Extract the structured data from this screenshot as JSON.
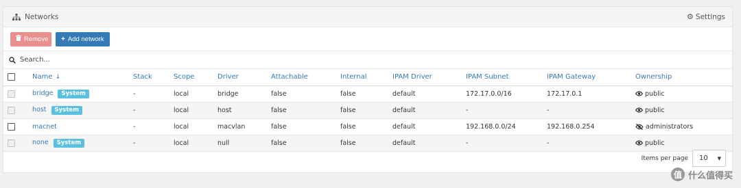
{
  "panel": {
    "title": "Networks",
    "settings_label": "Settings"
  },
  "toolbar": {
    "remove_label": "Remove",
    "add_label": "Add network"
  },
  "search": {
    "placeholder": "Search..."
  },
  "table": {
    "headers": {
      "name": "Name",
      "stack": "Stack",
      "scope": "Scope",
      "driver": "Driver",
      "attachable": "Attachable",
      "internal": "Internal",
      "ipam_driver": "IPAM Driver",
      "ipam_subnet": "IPAM Subnet",
      "ipam_gateway": "IPAM Gateway",
      "ownership": "Ownership"
    },
    "rows": [
      {
        "name": "bridge",
        "badge": "System",
        "stack": "-",
        "scope": "local",
        "driver": "bridge",
        "attachable": "false",
        "internal": "false",
        "ipam_driver": "default",
        "ipam_subnet": "172.17.0.0/16",
        "ipam_gateway": "172.17.0.1",
        "ownership": "public"
      },
      {
        "name": "host",
        "badge": "System",
        "stack": "-",
        "scope": "local",
        "driver": "host",
        "attachable": "false",
        "internal": "false",
        "ipam_driver": "default",
        "ipam_subnet": "-",
        "ipam_gateway": "-",
        "ownership": "public"
      },
      {
        "name": "macnet",
        "badge": "",
        "stack": "-",
        "scope": "local",
        "driver": "macvlan",
        "attachable": "false",
        "internal": "false",
        "ipam_driver": "default",
        "ipam_subnet": "192.168.0.0/24",
        "ipam_gateway": "192.168.0.254",
        "ownership": "administrators"
      },
      {
        "name": "none",
        "badge": "System",
        "stack": "-",
        "scope": "local",
        "driver": "null",
        "attachable": "false",
        "internal": "false",
        "ipam_driver": "default",
        "ipam_subnet": "-",
        "ipam_gateway": "-",
        "ownership": "public"
      }
    ]
  },
  "footer": {
    "items_per_page_label": "Items per page",
    "items_per_page_value": "10"
  },
  "watermark": {
    "text": "什么值得买",
    "logo_char": "值"
  }
}
